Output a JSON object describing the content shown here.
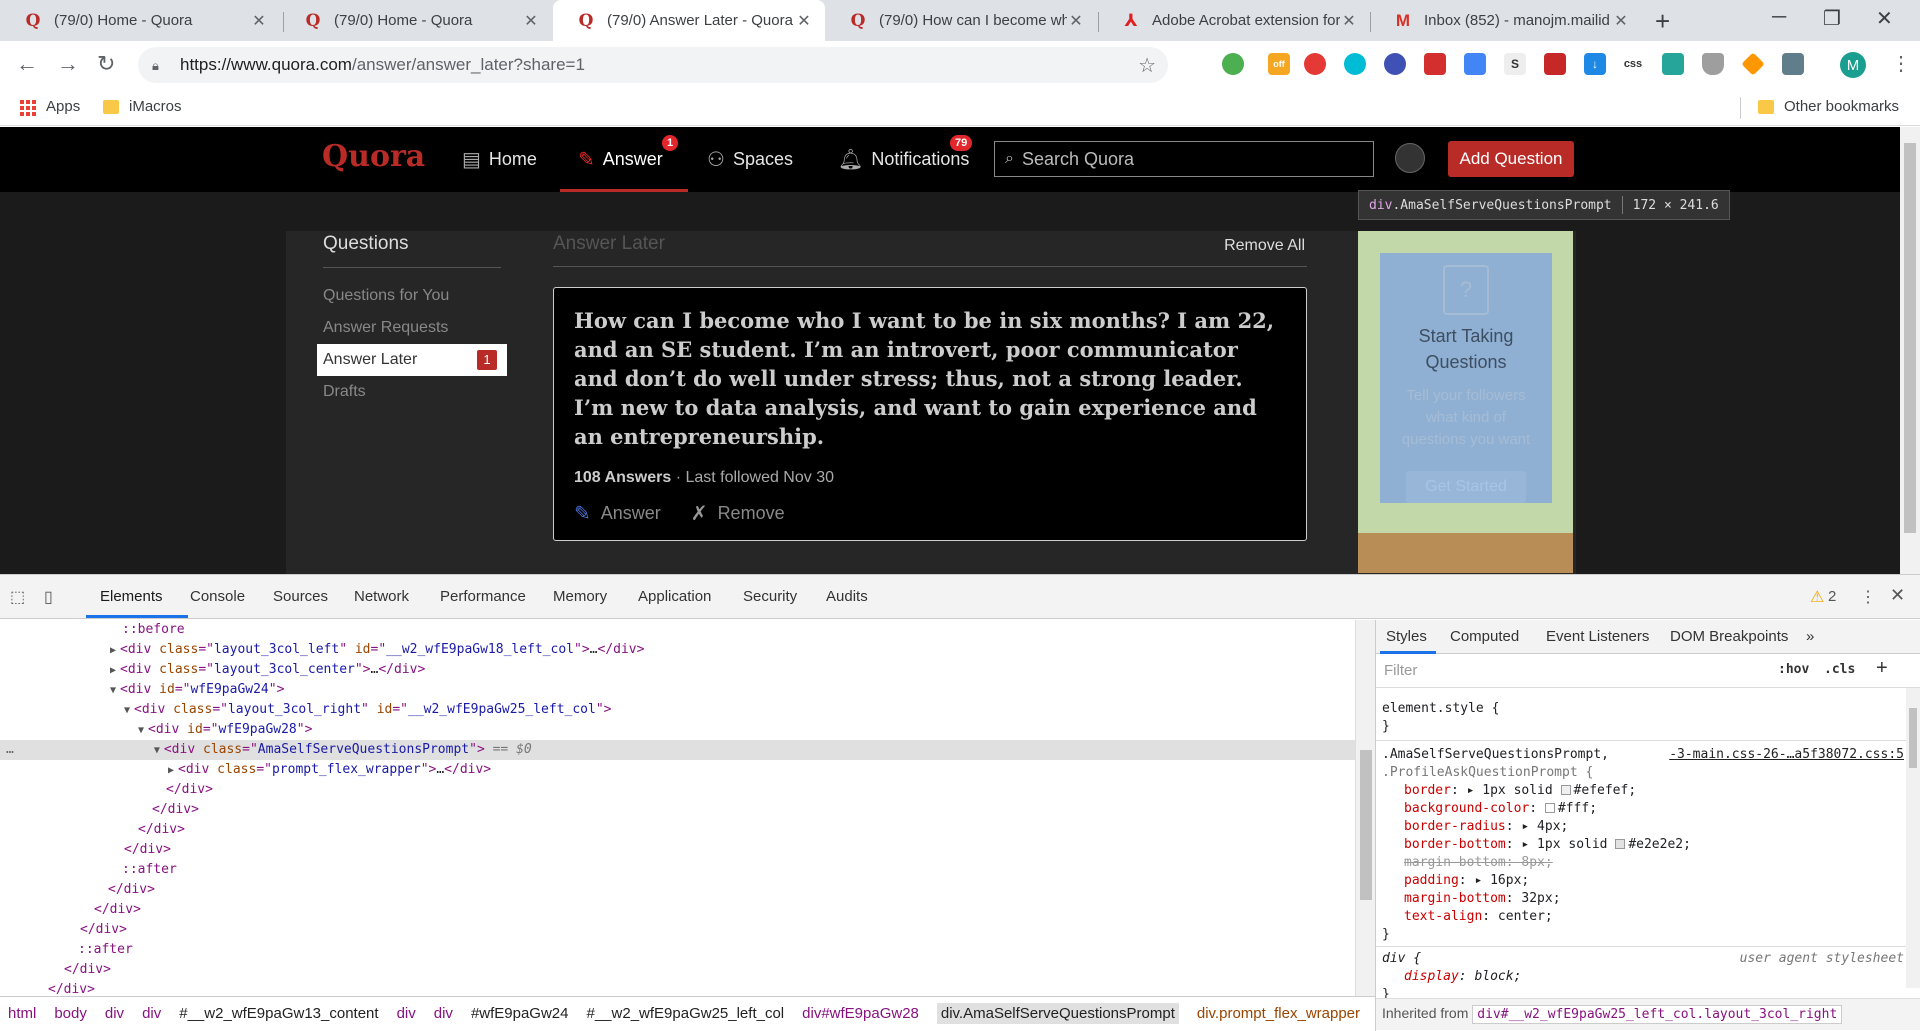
{
  "browser": {
    "tabs": [
      {
        "title": "(79/0) Home - Quora",
        "icon": "quora-icon",
        "active": false
      },
      {
        "title": "(79/0) Home - Quora",
        "icon": "quora-icon",
        "active": false
      },
      {
        "title": "(79/0) Answer Later - Quora",
        "icon": "quora-icon",
        "active": true
      },
      {
        "title": "(79/0) How can I become wh",
        "icon": "quora-icon",
        "active": false
      },
      {
        "title": "Adobe Acrobat extension for",
        "icon": "acrobat-icon",
        "active": false
      },
      {
        "title": "Inbox (852) - manojm.mailid",
        "icon": "gmail-icon",
        "active": false
      }
    ],
    "url_host": "https://www.quora.com",
    "url_path": "/answer/answer_later?share=1",
    "profile_initial": "M",
    "bookmarks": [
      {
        "label": "Apps",
        "icon": "apps-grid-icon"
      },
      {
        "label": "iMacros",
        "icon": "folder-icon"
      }
    ],
    "other_bookmarks": "Other bookmarks",
    "extension_badge": "off"
  },
  "quora": {
    "logo": "Quora",
    "nav": [
      {
        "label": "Home",
        "icon": "home-icon"
      },
      {
        "label": "Answer",
        "icon": "answer-pencil-icon",
        "badge": "1"
      },
      {
        "label": "Spaces",
        "icon": "spaces-icon"
      },
      {
        "label": "Notifications",
        "icon": "bell-icon",
        "badge": "79"
      }
    ],
    "search_placeholder": "Search Quora",
    "add_question": "Add Question",
    "left_title": "Questions",
    "left_items": [
      {
        "label": "Questions for You"
      },
      {
        "label": "Answer Requests"
      },
      {
        "label": "Answer Later",
        "badge": "1"
      },
      {
        "label": "Drafts"
      }
    ],
    "center_title": "Answer Later",
    "remove_all": "Remove All",
    "question": {
      "text": "How can I become who I want to be in six months? I am 22, and an SE student. I’m an introvert, poor communicator and don’t do well under stress; thus, not a strong leader. I’m new to data analysis, and want to gain experience and an entrepreneurship.",
      "answers": "108 Answers",
      "meta": " · Last followed Nov 30",
      "answer_label": "Answer",
      "remove_label": "Remove"
    },
    "prompt": {
      "title": "Start Taking Questions",
      "text": "Tell your followers what kind of questions you want",
      "button": "Get Started"
    },
    "tooltip": {
      "tag": "div",
      "cls": ".AmaSelfServeQuestionsPrompt",
      "size": "172 × 241.6"
    }
  },
  "devtools": {
    "tabs": [
      "Elements",
      "Console",
      "Sources",
      "Network",
      "Performance",
      "Memory",
      "Application",
      "Security",
      "Audits"
    ],
    "warnings": "2",
    "style_tabs": [
      "Styles",
      "Computed",
      "Event Listeners",
      "DOM Breakpoints"
    ],
    "filter_placeholder": "Filter",
    "hov": ":hov",
    "cls": ".cls",
    "breadcrumb": [
      "html",
      "body",
      "div",
      "div",
      "#__w2_wfE9paGw13_content",
      "div",
      "div",
      "#wfE9paGw24",
      "#__w2_wfE9paGw25_left_col",
      "div#wfE9paGw28",
      "div.AmaSelfServeQuestionsPrompt",
      "div.prompt_flex_wrapper"
    ],
    "inherited_label": "Inherited from",
    "inherited_from": "div#__w2_wfE9paGw25_left_col.layout_3col_right",
    "rule1_selector": ".AmaSelfServeQuestionsPrompt,",
    "rule1_selector2": ".ProfileAskQuestionPrompt {",
    "rule1_source": "-3-main.css-26-…a5f38072.css:5",
    "rule2_selector": "div {",
    "rule2_source": "user agent stylesheet",
    "element_style": "element.style {"
  }
}
